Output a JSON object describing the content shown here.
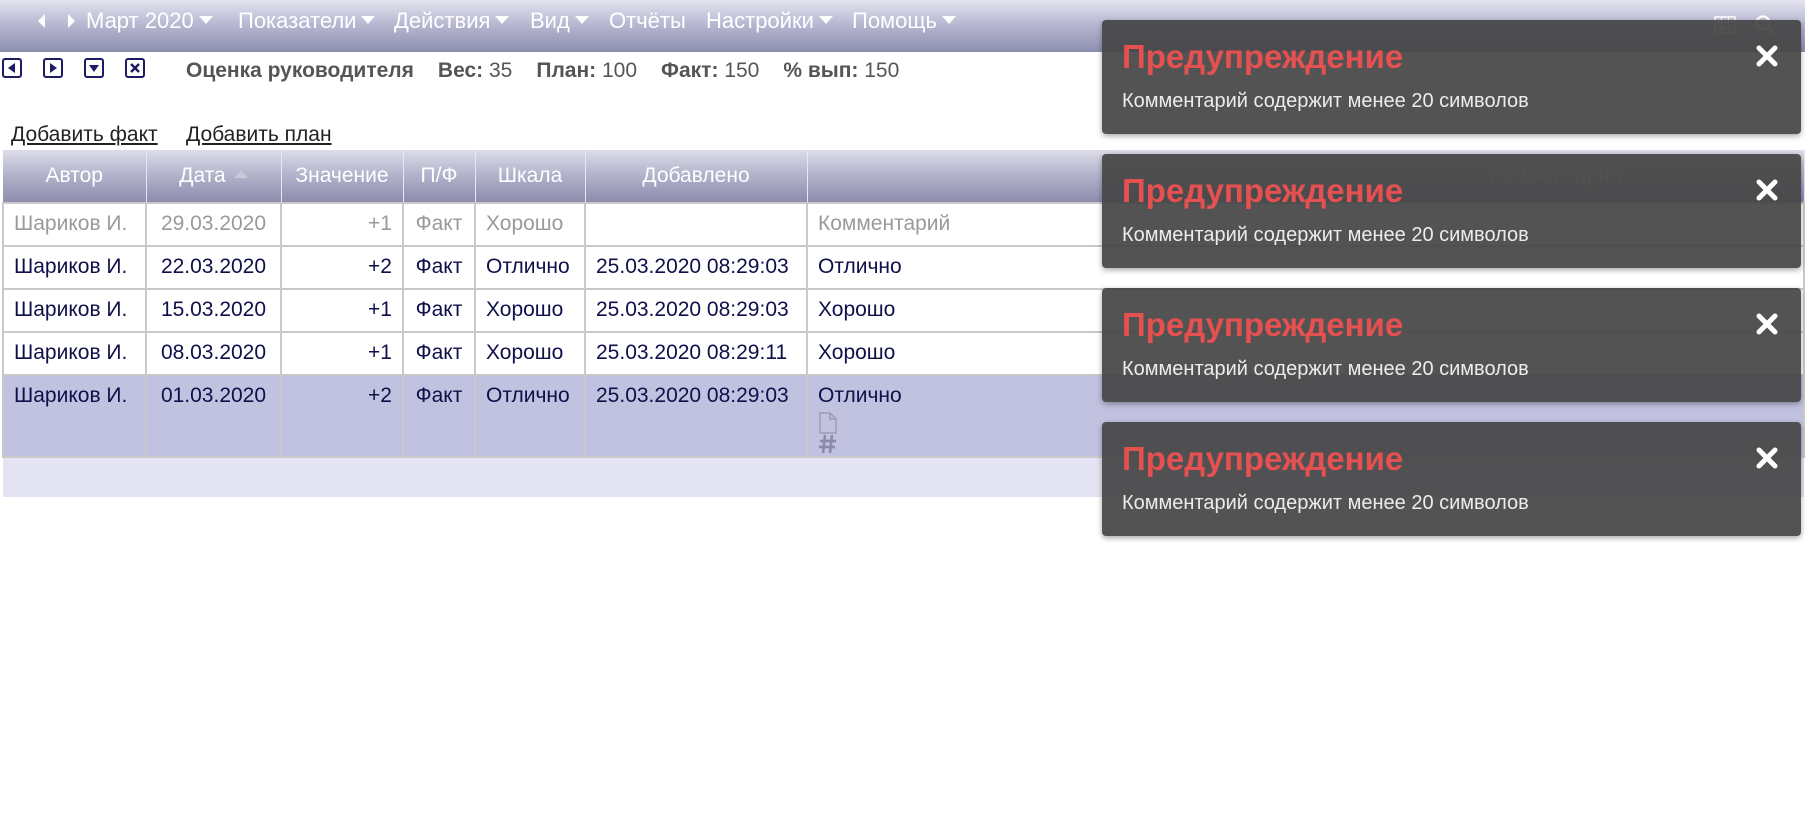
{
  "menubar": {
    "period": "Март 2020",
    "items": [
      {
        "label": "Показатели",
        "dropdown": true
      },
      {
        "label": "Действия",
        "dropdown": true
      },
      {
        "label": "Вид",
        "dropdown": true
      },
      {
        "label": "Отчёты",
        "dropdown": false
      },
      {
        "label": "Настройки",
        "dropdown": true
      },
      {
        "label": "Помощь",
        "dropdown": true
      }
    ],
    "right_icons": [
      "grid-icon",
      "search-icon"
    ]
  },
  "indicator": {
    "name": "Оценка руководителя",
    "weight_label": "Вес:",
    "weight": "35",
    "plan_label": "План:",
    "plan": "100",
    "fact_label": "Факт:",
    "fact": "150",
    "pct_label": "% вып:",
    "pct": "150"
  },
  "actions": {
    "add_fact": "Добавить факт",
    "add_plan": "Добавить план"
  },
  "table": {
    "columns": [
      "Автор",
      "Дата",
      "Значение",
      "П/Ф",
      "Шкала",
      "Добавлено",
      "Комментарий"
    ],
    "sorted_column": "Дата",
    "rows": [
      {
        "author": "Шариков И.",
        "date": "29.03.2020",
        "value": "+1",
        "pf": "Факт",
        "scale": "Хорошо",
        "added": "",
        "comment": "Комментарий",
        "draft": true
      },
      {
        "author": "Шариков И.",
        "date": "22.03.2020",
        "value": "+2",
        "pf": "Факт",
        "scale": "Отлично",
        "added": "25.03.2020 08:29:03",
        "comment": "Отлично"
      },
      {
        "author": "Шариков И.",
        "date": "15.03.2020",
        "value": "+1",
        "pf": "Факт",
        "scale": "Хорошо",
        "added": "25.03.2020 08:29:03",
        "comment": "Хорошо"
      },
      {
        "author": "Шариков И.",
        "date": "08.03.2020",
        "value": "+1",
        "pf": "Факт",
        "scale": "Хорошо",
        "added": "25.03.2020 08:29:11",
        "comment": "Хорошо"
      },
      {
        "author": "Шариков И.",
        "date": "01.03.2020",
        "value": "+2",
        "pf": "Факт",
        "scale": "Отлично",
        "added": "25.03.2020 08:29:03",
        "comment": "Отлично",
        "selected": true
      }
    ]
  },
  "warnings": [
    {
      "title": "Предупреждение",
      "text": "Комментарий содержит менее 20 символов"
    },
    {
      "title": "Предупреждение",
      "text": "Комментарий содержит менее 20 символов"
    },
    {
      "title": "Предупреждение",
      "text": "Комментарий содержит менее 20 символов"
    },
    {
      "title": "Предупреждение",
      "text": "Комментарий содержит менее 20 символов"
    }
  ],
  "colors": {
    "menu_gradient_top": "#e4e4ef",
    "menu_gradient_bottom": "#8e8eb0",
    "selected_row": "#c1c1e0",
    "warning_title": "#e55050",
    "warning_bg": "#464646"
  }
}
